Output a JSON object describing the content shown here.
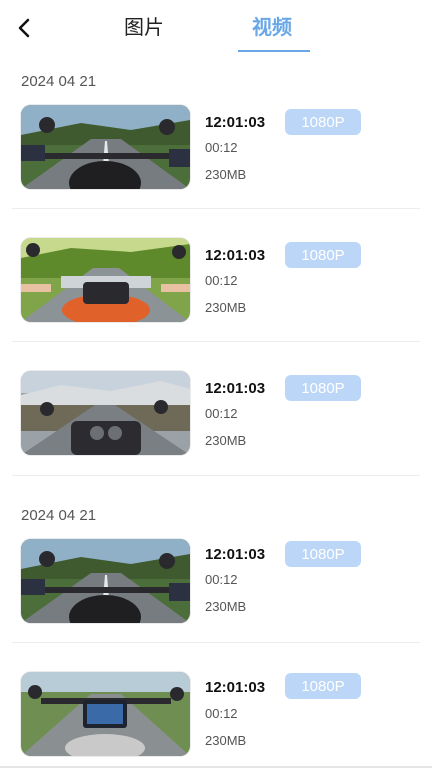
{
  "header": {
    "tabs": [
      {
        "label": "图片",
        "active": false
      },
      {
        "label": "视频",
        "active": true
      }
    ]
  },
  "groups": [
    {
      "date": "2024 04 21",
      "items": [
        {
          "time": "12:01:03",
          "duration": "00:12",
          "size": "230MB",
          "resolution": "1080P"
        },
        {
          "time": "12:01:03",
          "duration": "00:12",
          "size": "230MB",
          "resolution": "1080P"
        },
        {
          "time": "12:01:03",
          "duration": "00:12",
          "size": "230MB",
          "resolution": "1080P"
        }
      ]
    },
    {
      "date": "2024 04 21",
      "items": [
        {
          "time": "12:01:03",
          "duration": "00:12",
          "size": "230MB",
          "resolution": "1080P"
        },
        {
          "time": "12:01:03",
          "duration": "00:12",
          "size": "230MB",
          "resolution": "1080P"
        }
      ]
    }
  ],
  "colors": {
    "accent": "#6aa7e6",
    "badge_bg": "#bcd6f7"
  }
}
